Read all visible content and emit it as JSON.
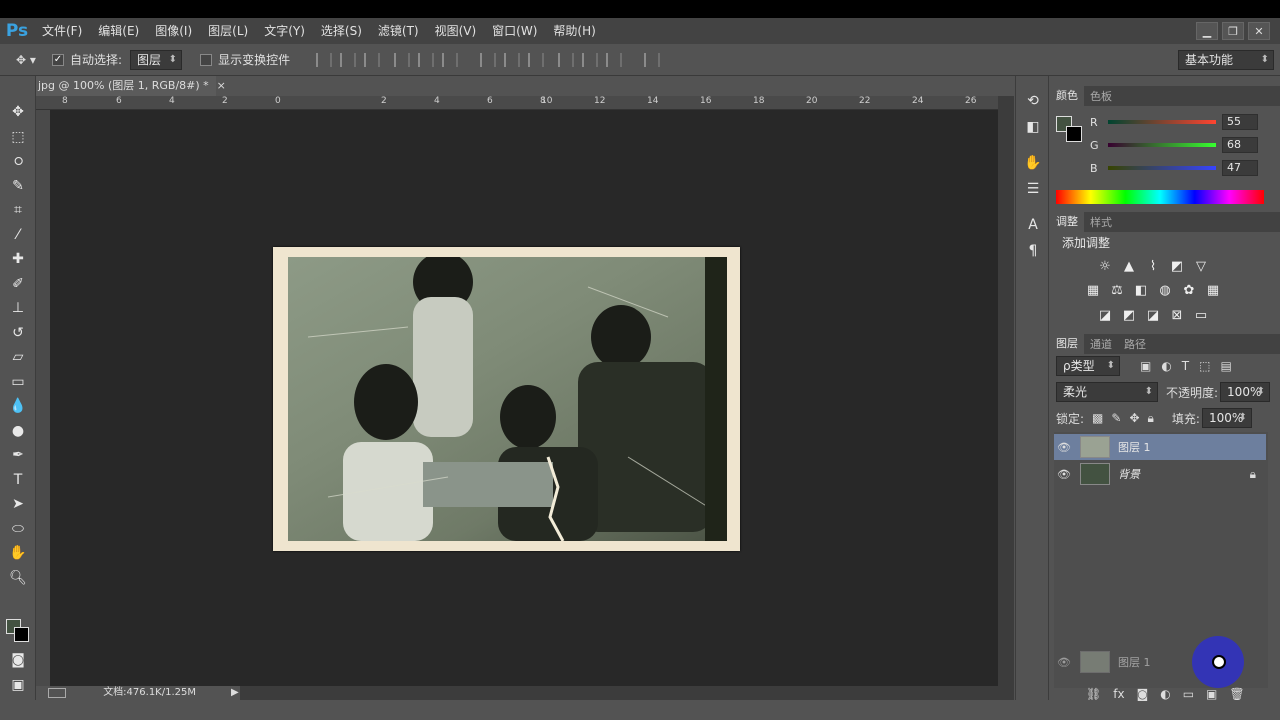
{
  "app": {
    "logo": "Ps"
  },
  "menu": [
    "文件(F)",
    "编辑(E)",
    "图像(I)",
    "图层(L)",
    "文字(Y)",
    "选择(S)",
    "滤镜(T)",
    "视图(V)",
    "窗口(W)",
    "帮助(H)"
  ],
  "window_controls": [
    "minimize-icon",
    "restore-icon",
    "close-icon"
  ],
  "options_bar": {
    "auto_select_label": "自动选择:",
    "auto_select_checked": true,
    "auto_select_value": "图层",
    "show_transform_label": "显示变换控件",
    "show_transform_checked": false,
    "workspace": "基本功能"
  },
  "document": {
    "tab_title": "jpg @ 100% (图层 1, RGB/8#) *",
    "tab_close": "×",
    "status": "文档:476.1K/1.25M",
    "ruler_labels": [
      "8",
      "6",
      "4",
      "2",
      "0",
      "2",
      "4",
      "6",
      "8",
      "10",
      "12",
      "14",
      "16",
      "18",
      "20",
      "22",
      "24",
      "26"
    ]
  },
  "toolbar_tools": [
    "move-tool-icon",
    "marquee-tool-icon",
    "lasso-tool-icon",
    "quick-select-icon",
    "crop-icon",
    "eyedropper-icon",
    "healing-brush-icon",
    "brush-icon",
    "stamp-icon",
    "history-brush-icon",
    "eraser-icon",
    "gradient-icon",
    "blur-icon",
    "dodge-icon",
    "pen-icon",
    "type-icon",
    "path-select-icon",
    "ellipse-icon",
    "hand-icon",
    "zoom-icon"
  ],
  "colors": {
    "foreground": "#435241",
    "background": "#000000"
  },
  "color_panel": {
    "tabs": [
      "颜色",
      "色板"
    ],
    "r": "55",
    "g": "68",
    "b": "47"
  },
  "adjust_panel": {
    "tabs": [
      "调整",
      "样式"
    ],
    "title": "添加调整"
  },
  "layers_panel": {
    "tabs": [
      "图层",
      "通道",
      "路径"
    ],
    "filter": "ρ类型",
    "blend_mode": "柔光",
    "opacity_label": "不透明度:",
    "opacity": "100%",
    "lock_label": "锁定:",
    "fill_label": "填充:",
    "fill": "100%",
    "layers": [
      {
        "name": "图层 1",
        "selected": true
      },
      {
        "name": "背景",
        "selected": false,
        "locked": true
      }
    ],
    "drag_ghost": "图层 1"
  }
}
